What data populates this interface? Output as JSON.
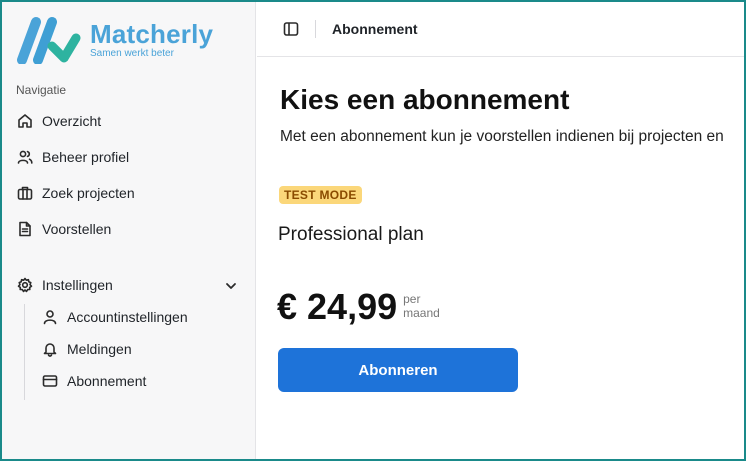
{
  "brand": {
    "name": "Matcherly",
    "tagline": "Samen werkt beter",
    "color": "#4aa3d8"
  },
  "sidebar": {
    "heading": "Navigatie",
    "items": [
      {
        "label": "Overzicht",
        "icon": "home-icon"
      },
      {
        "label": "Beheer profiel",
        "icon": "users-icon"
      },
      {
        "label": "Zoek projecten",
        "icon": "briefcase-icon"
      },
      {
        "label": "Voorstellen",
        "icon": "document-icon"
      }
    ],
    "settings": {
      "label": "Instellingen",
      "icon": "gear-icon",
      "expanded": true,
      "children": [
        {
          "label": "Accountinstellingen",
          "icon": "user-icon"
        },
        {
          "label": "Meldingen",
          "icon": "bell-icon"
        },
        {
          "label": "Abonnement",
          "icon": "credit-card-icon"
        }
      ]
    }
  },
  "header": {
    "breadcrumb": "Abonnement",
    "toggle_icon": "sidebar-toggle-icon"
  },
  "main": {
    "title": "Kies een abonnement",
    "description": "Met een abonnement kun je voorstellen indienen bij projecten en",
    "badge": "TEST MODE",
    "plan_name": "Professional plan",
    "price": "€ 24,99",
    "period_line1": "per",
    "period_line2": "maand",
    "subscribe_label": "Abonneren",
    "accent_color": "#1e73d9",
    "badge_color": "#fbd77a"
  }
}
